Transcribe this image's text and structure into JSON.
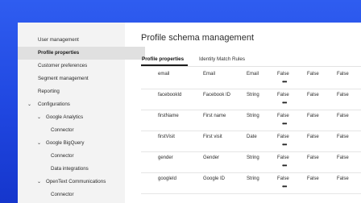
{
  "sidebar": {
    "items": [
      {
        "label": "User management"
      },
      {
        "label": "Profile properties"
      },
      {
        "label": "Customer preferences"
      },
      {
        "label": "Segment management"
      },
      {
        "label": "Reporting"
      },
      {
        "label": "Configurations"
      },
      {
        "label": "Google Analytics"
      },
      {
        "label": "Connector"
      },
      {
        "label": "Google BigQuery"
      },
      {
        "label": "Connector"
      },
      {
        "label": "Data integrations"
      },
      {
        "label": "OpenText Communications"
      },
      {
        "label": "Connector"
      }
    ]
  },
  "page": {
    "title": "Profile schema management"
  },
  "tabs": [
    {
      "label": "Profile properties"
    },
    {
      "label": "Identity Match Rules"
    }
  ],
  "table": {
    "more_glyph": "•••",
    "rows": [
      {
        "name": "email",
        "display": "Email",
        "type": "Email",
        "f1": "False",
        "f2": "False",
        "f3": "False"
      },
      {
        "name": "facebookId",
        "display": "Facebook ID",
        "type": "String",
        "f1": "False",
        "f2": "False",
        "f3": "False"
      },
      {
        "name": "firstName",
        "display": "First name",
        "type": "String",
        "f1": "False",
        "f2": "False",
        "f3": "False"
      },
      {
        "name": "firstVisit",
        "display": "First visit",
        "type": "Date",
        "f1": "False",
        "f2": "False",
        "f3": "False"
      },
      {
        "name": "gender",
        "display": "Gender",
        "type": "String",
        "f1": "False",
        "f2": "False",
        "f3": "False"
      },
      {
        "name": "googleId",
        "display": "Google ID",
        "type": "String",
        "f1": "False",
        "f2": "False",
        "f3": "False"
      }
    ]
  },
  "icons": {
    "collapse": "chevron-down-icon"
  },
  "colors": {
    "background": "#2450e8",
    "sidebar": "#f3f3f3",
    "active_item": "#e0e0e0"
  }
}
